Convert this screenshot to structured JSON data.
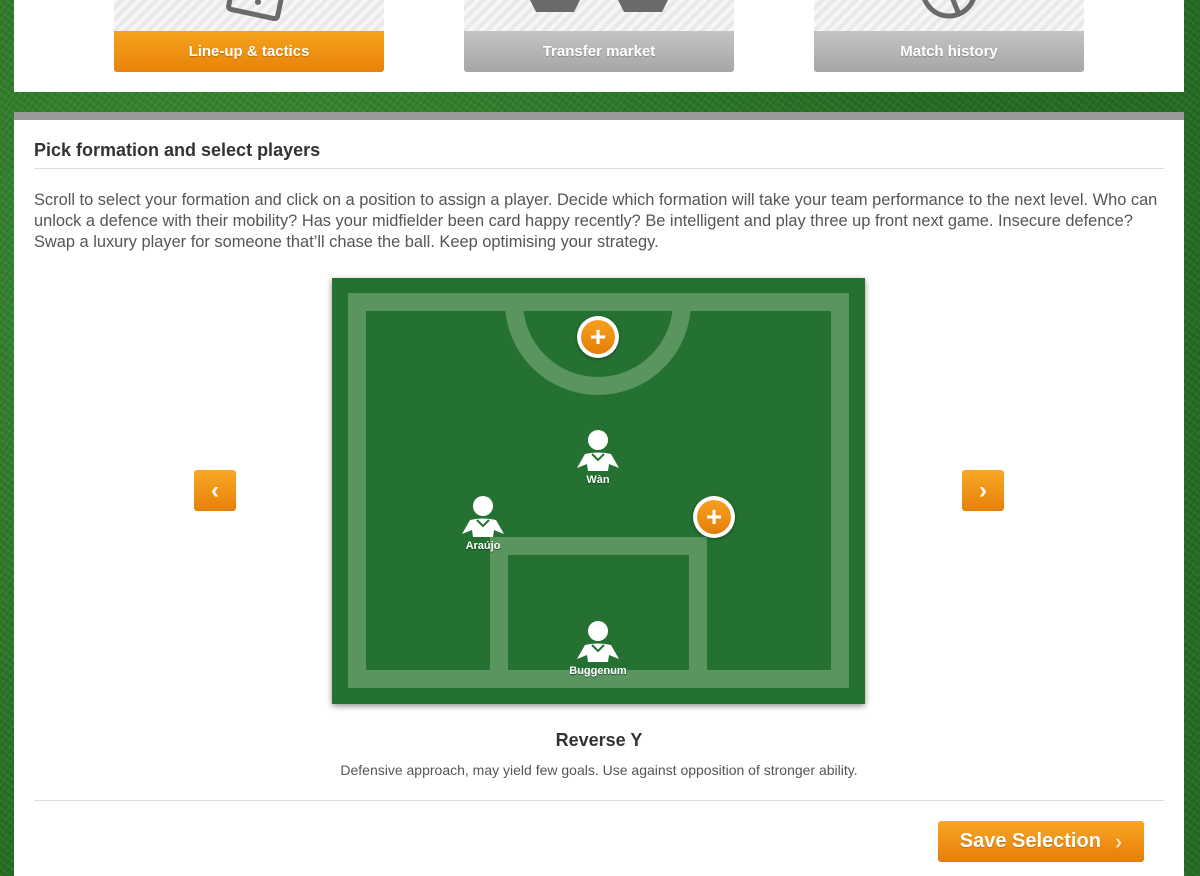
{
  "nav": {
    "tabs": [
      {
        "label": "Line-up & tactics",
        "active": true,
        "icon": "tactics-board-icon"
      },
      {
        "label": "Transfer market",
        "active": false,
        "icon": "shirts-icon"
      },
      {
        "label": "Match history",
        "active": false,
        "icon": "clock-icon"
      }
    ]
  },
  "section": {
    "title": "Pick formation and select players",
    "intro": "Scroll to select your formation and click on a position to assign a player. Decide which formation will take your team performance to the next level. Who can unlock a defence with their mobility? Has your midfielder been card happy recently? Be intelligent and play three up front next game. Insecure defence? Swap a luxury player for someone that’ll chase the ball. Keep optimising your strategy."
  },
  "formation": {
    "name": "Reverse Y",
    "description": "Defensive approach, may yield few goals. Use against opposition of stronger ability.",
    "players": [
      {
        "name": "Wàn"
      },
      {
        "name": "Araújo"
      },
      {
        "name": "Buggenum"
      }
    ],
    "empty_slot_symbol": "+"
  },
  "controls": {
    "prev_symbol": "‹",
    "next_symbol": "›",
    "save_label": "Save Selection",
    "save_chevron": "›"
  },
  "colors": {
    "accent": "#f39a17",
    "pitch": "#247132",
    "pitch_lines": "#5a9560"
  }
}
